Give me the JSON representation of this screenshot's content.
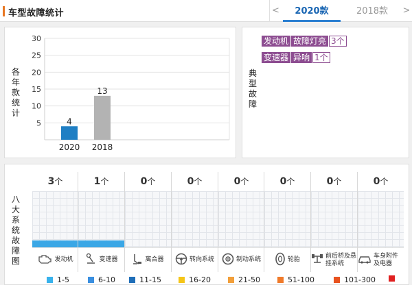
{
  "header": {
    "title": "车型故障统计",
    "prev_label": "<",
    "next_label": ">",
    "tabs": [
      {
        "label": "2020款",
        "active": true
      },
      {
        "label": "2018款",
        "active": false
      }
    ],
    "accent_color": "#e87722"
  },
  "year_panel": {
    "ylabel": "各年款统计"
  },
  "chart_data": {
    "type": "bar",
    "categories": [
      "2020",
      "2018"
    ],
    "values": [
      4,
      13
    ],
    "bar_colors": [
      "#1f7fc4",
      "#b3b3b3"
    ],
    "data_labels": [
      "4",
      "13"
    ],
    "yticks": [
      "5",
      "10",
      "15",
      "20",
      "25",
      "30"
    ],
    "ylim": [
      0,
      30
    ],
    "ylabel": "各年款统计",
    "grid": true
  },
  "typical_panel": {
    "label": "典型故障",
    "faults": [
      {
        "system": "发动机",
        "symptom": "故障灯亮",
        "count": "3个"
      },
      {
        "system": "变速器",
        "symptom": "异响",
        "count": "1个"
      }
    ],
    "tag_color": "#8d4d91"
  },
  "systems_panel": {
    "label": "八大系统故障图",
    "unit": "个",
    "systems": [
      {
        "name": "发动机",
        "count": "3",
        "fill": 0.12,
        "icon": "engine-icon"
      },
      {
        "name": "变速器",
        "count": "1",
        "fill": 0.12,
        "icon": "gear-shift-icon"
      },
      {
        "name": "离合器",
        "count": "0",
        "fill": 0,
        "icon": "clutch-pedal-icon"
      },
      {
        "name": "转向系统",
        "count": "0",
        "fill": 0,
        "icon": "steering-wheel-icon"
      },
      {
        "name": "制动系统",
        "count": "0",
        "fill": 0,
        "icon": "brake-disc-icon"
      },
      {
        "name": "轮胎",
        "count": "0",
        "fill": 0,
        "icon": "tire-icon"
      },
      {
        "name": "前后桥及悬挂系统",
        "count": "0",
        "fill": 0,
        "icon": "axle-icon"
      },
      {
        "name": "车身附件及电器",
        "count": "0",
        "fill": 0,
        "icon": "car-body-icon"
      }
    ],
    "fill_color": "#3aa7e6"
  },
  "legend": [
    {
      "label": "1-5",
      "color": "#38b2ec"
    },
    {
      "label": "6-10",
      "color": "#3a8fe0"
    },
    {
      "label": "11-15",
      "color": "#1f6eb8"
    },
    {
      "label": "16-20",
      "color": "#f5c518"
    },
    {
      "label": "21-50",
      "color": "#f29f3a"
    },
    {
      "label": "51-100",
      "color": "#f07a2a"
    },
    {
      "label": "101-300",
      "color": "#e8521f"
    },
    {
      "label": "",
      "color": "#e02020"
    }
  ]
}
